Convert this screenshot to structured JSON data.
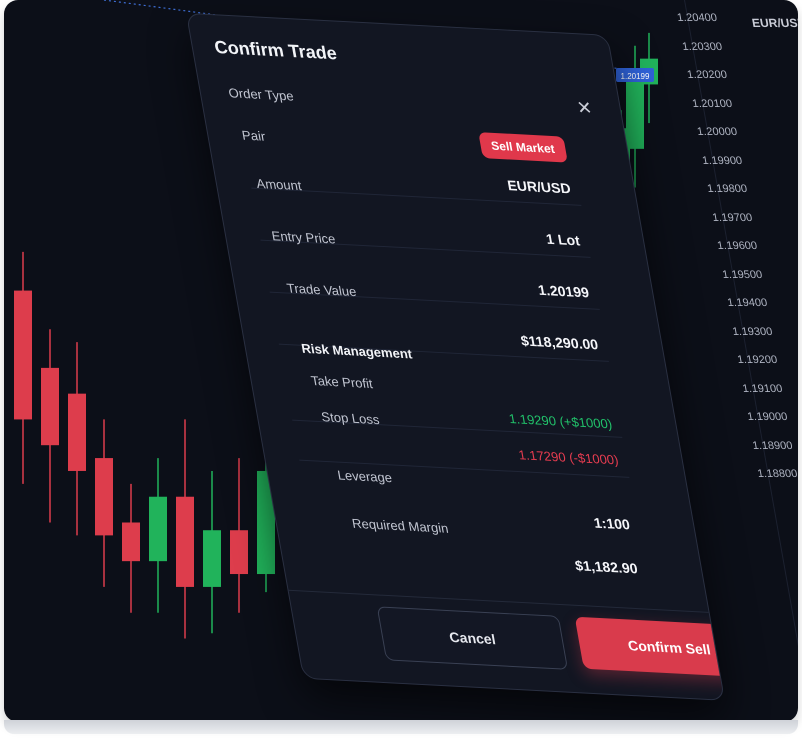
{
  "modal": {
    "title": "Confirm Trade",
    "close_icon": "close-icon",
    "badge": "Sell Market",
    "rows": [
      {
        "label": "Order Type",
        "value": ""
      },
      {
        "label": "Pair",
        "value": "EUR/USD"
      },
      {
        "label": "Amount",
        "value": "1 Lot"
      },
      {
        "label": "Entry Price",
        "value": "1.20199"
      },
      {
        "label": "Trade Value",
        "value": "$118,290.00"
      }
    ],
    "risk": {
      "title": "Risk Management",
      "take_profit_label": "Take Profit",
      "take_profit_value": "1.19290 (+$1000)",
      "stop_loss_label": "Stop Loss",
      "stop_loss_value": "1.17290 (-$1000)"
    },
    "leverage_label": "Leverage",
    "leverage_value": "1:100",
    "margin_label": "Required Margin",
    "margin_value": "$1,182.90",
    "cancel_label": "Cancel",
    "confirm_label": "Confirm Sell"
  },
  "price_axis": {
    "header": "EUR/USD",
    "ticks": [
      "1.20400",
      "1.20300",
      "1.20200",
      "1.20100",
      "1.20000",
      "1.19900",
      "1.19800",
      "1.19700",
      "1.19600",
      "1.19500",
      "1.19400",
      "1.19300",
      "1.19200",
      "1.19100",
      "1.19000",
      "1.18900",
      "1.18800"
    ],
    "current_price_tag": "1.20199"
  },
  "colors": {
    "bull": "#21b35b",
    "bear": "#dd3d4c",
    "background": "#0c0f18"
  },
  "chart_data": {
    "type": "candlestick",
    "candles": [
      {
        "o": 1.1955,
        "c": 1.1905,
        "h": 1.197,
        "l": 1.188
      },
      {
        "o": 1.1925,
        "c": 1.1895,
        "h": 1.194,
        "l": 1.1865
      },
      {
        "o": 1.1915,
        "c": 1.1885,
        "h": 1.1935,
        "l": 1.186
      },
      {
        "o": 1.189,
        "c": 1.186,
        "h": 1.1905,
        "l": 1.184
      },
      {
        "o": 1.1865,
        "c": 1.185,
        "h": 1.188,
        "l": 1.183
      },
      {
        "o": 1.185,
        "c": 1.1875,
        "h": 1.189,
        "l": 1.183
      },
      {
        "o": 1.1875,
        "c": 1.184,
        "h": 1.1905,
        "l": 1.182
      },
      {
        "o": 1.184,
        "c": 1.1862,
        "h": 1.1885,
        "l": 1.1822
      },
      {
        "o": 1.1862,
        "c": 1.1845,
        "h": 1.189,
        "l": 1.183
      },
      {
        "o": 1.1845,
        "c": 1.1885,
        "h": 1.1915,
        "l": 1.1838
      },
      {
        "o": 1.1975,
        "c": 1.1945,
        "h": 1.199,
        "l": 1.1935
      },
      {
        "o": 1.199,
        "c": 1.2005,
        "h": 1.2015,
        "l": 1.1985
      },
      {
        "o": 1.1998,
        "c": 1.2018,
        "h": 1.2025,
        "l": 1.1988
      },
      {
        "o": 1.201,
        "c": 1.204,
        "h": 1.205,
        "l": 1.1995
      },
      {
        "o": 1.2035,
        "c": 1.2045,
        "h": 1.2055,
        "l": 1.202
      }
    ],
    "ylim": [
      1.18,
      1.206
    ]
  }
}
